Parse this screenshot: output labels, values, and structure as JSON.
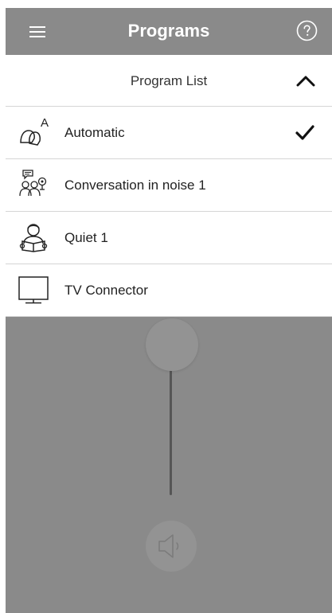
{
  "header": {
    "title": "Programs",
    "menu_icon": "hamburger-menu-icon",
    "help_icon": "help-circle-icon"
  },
  "dropdown": {
    "title": "Program List",
    "toggle_icon": "chevron-up-icon",
    "items": [
      {
        "label": "Automatic",
        "icon": "hearing-aid-auto-icon",
        "selected": true
      },
      {
        "label": "Conversation in noise 1",
        "icon": "conversation-in-noise-icon",
        "selected": false
      },
      {
        "label": "Quiet 1",
        "icon": "reading-person-icon",
        "selected": false
      },
      {
        "label": "TV Connector",
        "icon": "tv-icon",
        "selected": false
      }
    ]
  },
  "volume": {
    "speaker_icon": "speaker-volume-icon"
  },
  "colors": {
    "header_bg": "#8a8a8a",
    "overlay_bg": "#8a8a8a",
    "list_bg": "#ffffff",
    "divider": "#d5d5d5"
  }
}
